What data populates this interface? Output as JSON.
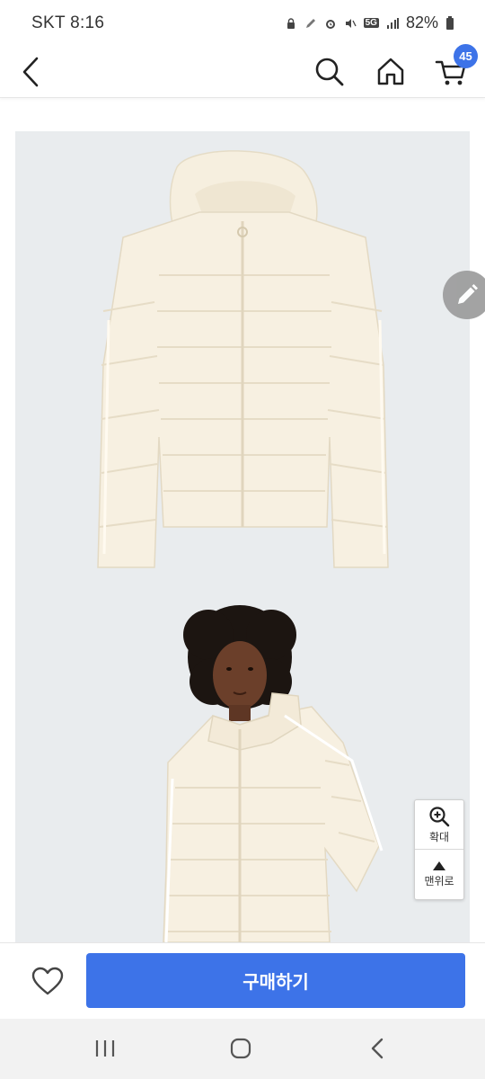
{
  "status": {
    "carrier_time": "SKT 8:16",
    "network": "5G",
    "battery": "82%"
  },
  "header": {
    "cart_count": "45",
    "accent_color": "#3d73e8"
  },
  "side_tools": {
    "zoom_label": "확대",
    "top_label": "맨위로"
  },
  "purchase": {
    "buy_label": "구매하기"
  },
  "icons": {
    "back": "chevron-left-icon",
    "search": "search-icon",
    "home": "home-icon",
    "cart": "cart-icon",
    "edit": "pencil-icon",
    "zoom": "zoom-in-icon",
    "scroll_top": "triangle-up-icon",
    "wish": "heart-icon"
  }
}
